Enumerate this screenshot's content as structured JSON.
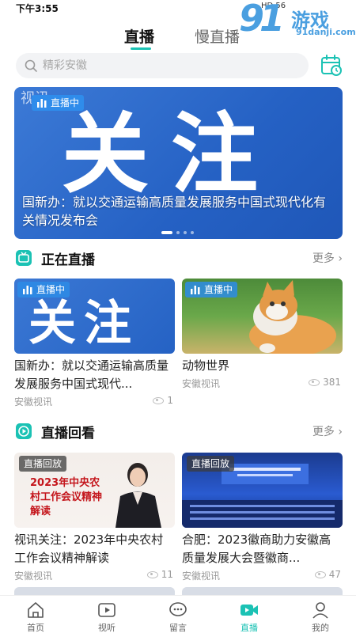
{
  "status_bar": {
    "time": "下午3:55",
    "indicators": "HD 56"
  },
  "watermark": {
    "num": "91",
    "text": "游戏",
    "url": "91danji.com"
  },
  "top_tabs": [
    {
      "label": "直播",
      "active": true
    },
    {
      "label": "慢直播",
      "active": false
    }
  ],
  "search": {
    "placeholder": "精彩安徽"
  },
  "banner": {
    "big_word": "关注",
    "logo_text": "视讯",
    "badge": "直播中",
    "caption": "国新办：就以交通运输高质量发展服务中国式现代化有关情况发布会",
    "page_count": 4,
    "active_page": 0
  },
  "live_section": {
    "title": "正在直播",
    "more": "更多",
    "cards": [
      {
        "badge": "直播中",
        "thumb_word": "关注",
        "title": "国新办：就以交通运输高质量发展服务中国式现代...",
        "source": "安徽视讯",
        "views": "1"
      },
      {
        "badge": "直播中",
        "title": "动物世界",
        "source": "安徽视讯",
        "views": "381"
      }
    ]
  },
  "replay_section": {
    "title": "直播回看",
    "more": "更多",
    "cards": [
      {
        "badge": "直播回放",
        "thumb_text": "2023年中央农村工作会议精神解读",
        "title": "视讯关注：2023年中央农村工作会议精神解读",
        "source": "安徽视讯",
        "views": "11"
      },
      {
        "badge": "直播回放",
        "title": "合肥：2023徽商助力安徽高质量发展大会暨徽商...",
        "source": "安徽视讯",
        "views": "47"
      }
    ]
  },
  "bottom_nav": [
    {
      "label": "首页",
      "icon": "home-icon",
      "active": false
    },
    {
      "label": "视听",
      "icon": "play-icon",
      "active": false
    },
    {
      "label": "留言",
      "icon": "message-icon",
      "active": false
    },
    {
      "label": "直播",
      "icon": "live-camera-icon",
      "active": true
    },
    {
      "label": "我的",
      "icon": "user-icon",
      "active": false
    }
  ],
  "colors": {
    "accent": "#1bc2b4",
    "badge_blue": "#2f8ceb",
    "banner_blue": "#2561c4"
  }
}
